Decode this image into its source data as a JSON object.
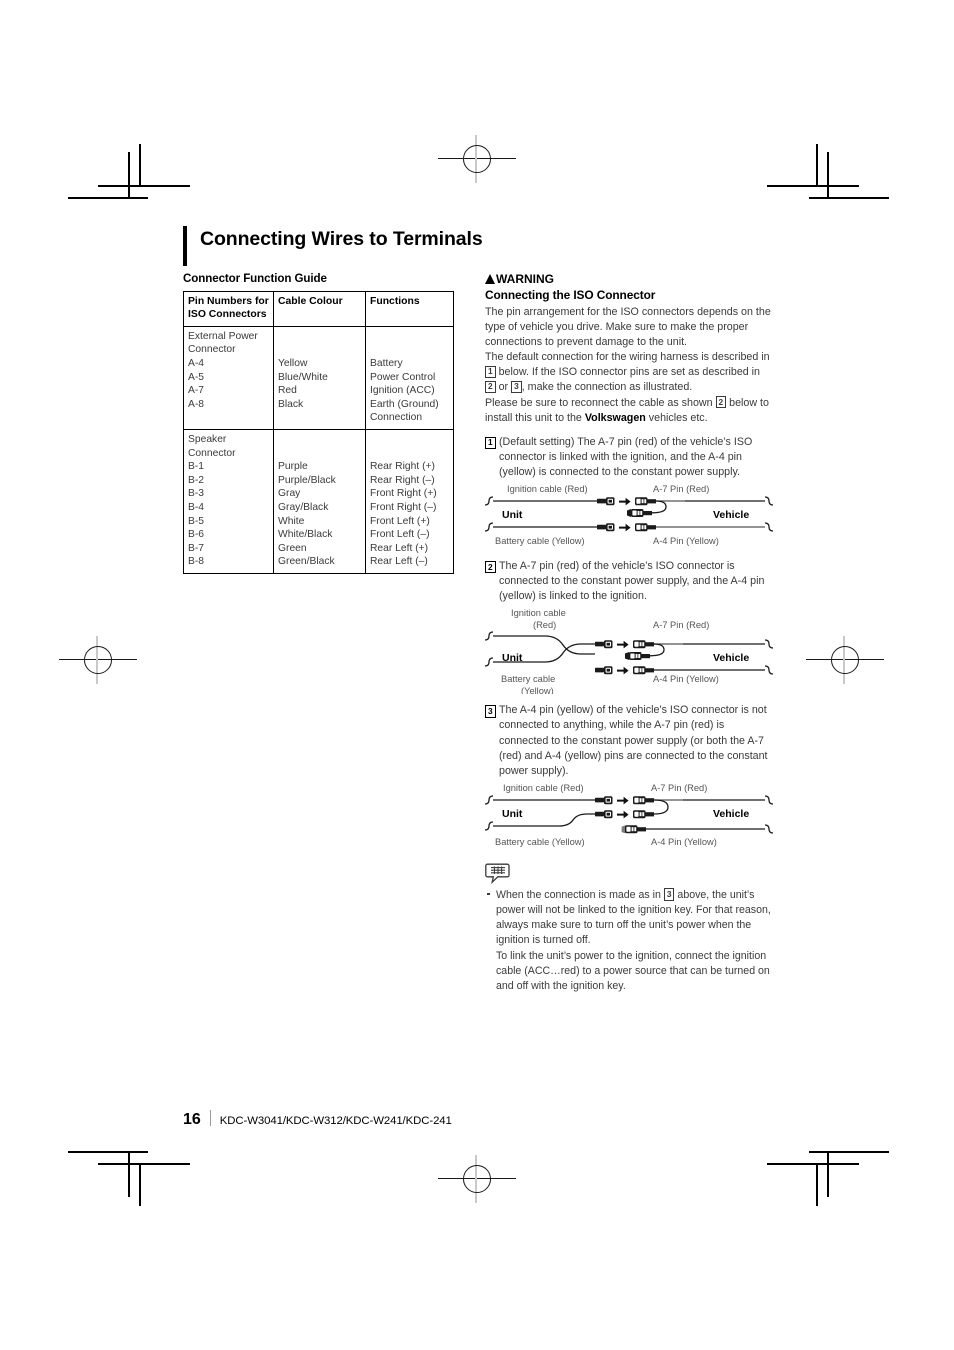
{
  "document": {
    "title": "Connecting Wires to Terminals"
  },
  "left_column": {
    "section_heading": "Connector Function Guide",
    "table": {
      "headers": [
        "Pin Numbers for ISO Connectors",
        "Cable Colour",
        "Functions"
      ],
      "header_lines": [
        [
          "Pin Numbers for",
          "ISO Connectors"
        ],
        [
          "Cable Colour"
        ],
        [
          "Functions"
        ]
      ],
      "groups": [
        {
          "name": "External Power Connector",
          "pin_lines": [
            "External Power",
            "Connector",
            "A-4",
            "A-5",
            "A-7",
            "A-8"
          ],
          "colour_lines": [
            "Yellow",
            "Blue/White",
            "Red",
            "Black"
          ],
          "function_lines": [
            "Battery",
            "Power Control",
            "Ignition (ACC)",
            "Earth (Ground)",
            "Connection"
          ],
          "rows": [
            {
              "pin": "A-4",
              "colour": "Yellow",
              "function": "Battery"
            },
            {
              "pin": "A-5",
              "colour": "Blue/White",
              "function": "Power Control"
            },
            {
              "pin": "A-7",
              "colour": "Red",
              "function": "Ignition (ACC)"
            },
            {
              "pin": "A-8",
              "colour": "Black",
              "function": "Earth (Ground) Connection"
            }
          ]
        },
        {
          "name": "Speaker Connector",
          "pin_lines": [
            "Speaker",
            "Connector",
            "B-1",
            "B-2",
            "B-3",
            "B-4",
            "B-5",
            "B-6",
            "B-7",
            "B-8"
          ],
          "colour_lines": [
            "Purple",
            "Purple/Black",
            "Gray",
            "Gray/Black",
            "White",
            "White/Black",
            "Green",
            "Green/Black"
          ],
          "function_lines": [
            "Rear Right (+)",
            "Rear Right (–)",
            "Front Right (+)",
            "Front Right (–)",
            "Front Left (+)",
            "Front Left (–)",
            "Rear Left (+)",
            "Rear Left (–)"
          ],
          "rows": [
            {
              "pin": "B-1",
              "colour": "Purple",
              "function": "Rear Right (+)"
            },
            {
              "pin": "B-2",
              "colour": "Purple/Black",
              "function": "Rear Right (–)"
            },
            {
              "pin": "B-3",
              "colour": "Gray",
              "function": "Front Right (+)"
            },
            {
              "pin": "B-4",
              "colour": "Gray/Black",
              "function": "Front Right (–)"
            },
            {
              "pin": "B-5",
              "colour": "White",
              "function": "Front Left (+)"
            },
            {
              "pin": "B-6",
              "colour": "White/Black",
              "function": "Front Left (–)"
            },
            {
              "pin": "B-7",
              "colour": "Green",
              "function": "Rear Left (+)"
            },
            {
              "pin": "B-8",
              "colour": "Green/Black",
              "function": "Rear Left (–)"
            }
          ]
        }
      ]
    }
  },
  "right_column": {
    "warning_label": "WARNING",
    "warning_heading": "Connecting the ISO Connector",
    "intro_paragraph_1": "The pin arrangement for the ISO connectors depends on the type of vehicle you drive. Make sure to make the proper connections to prevent damage to the unit.",
    "intro_paragraph_2_a": "The default connection for the wiring harness is described in",
    "intro_paragraph_2_b": "below. If the ISO connector pins are set as described in",
    "intro_paragraph_2_c": "or",
    "intro_paragraph_2_d": ", make the connection as illustrated.",
    "intro_paragraph_3_a": "Please be sure to reconnect the cable as shown",
    "intro_paragraph_3_b": "below to install this unit to the",
    "intro_paragraph_3_brand": "Volkswagen",
    "intro_paragraph_3_c": "vehicles etc.",
    "items": [
      {
        "number": "1",
        "text": "(Default setting) The A-7 pin (red) of the vehicle’s ISO connector is linked with the ignition, and the A-4 pin (yellow) is connected to the constant power supply.",
        "diagram": {
          "top_left_label": "Ignition cable (Red)",
          "top_right_label": "A-7 Pin (Red)",
          "bottom_left_label": "Battery cable (Yellow)",
          "bottom_right_label": "A-4 Pin (Yellow)",
          "unit_label": "Unit",
          "vehicle_label": "Vehicle"
        }
      },
      {
        "number": "2",
        "text": "The A-7 pin (red) of the vehicle’s ISO connector is connected to the constant power supply, and the A-4 pin (yellow) is linked to the ignition.",
        "diagram": {
          "top_left_label_line1": "Ignition cable",
          "top_left_label_line2": "(Red)",
          "top_right_label": "A-7 Pin (Red)",
          "bottom_left_label_line1": "Battery cable",
          "bottom_left_label_line2": "(Yellow)",
          "bottom_right_label": "A-4 Pin (Yellow)",
          "unit_label": "Unit",
          "vehicle_label": "Vehicle"
        }
      },
      {
        "number": "3",
        "text": "The A-4 pin (yellow) of the vehicle’s ISO connector is not connected to anything, while the A-7 pin (red) is connected to the constant power supply (or both the A-7 (red) and A-4 (yellow) pins are connected to the constant power supply).",
        "diagram": {
          "top_left_label": "Ignition cable (Red)",
          "top_right_label": "A-7 Pin (Red)",
          "bottom_left_label": "Battery cable (Yellow)",
          "bottom_right_label": "A-4 Pin (Yellow)",
          "unit_label": "Unit",
          "vehicle_label": "Vehicle"
        }
      }
    ],
    "note": {
      "icon": "note-speech-bubble-icon",
      "bullet_part_1": "When the connection is made as in",
      "bullet_number": "3",
      "bullet_part_2": "above, the unit’s power will not be linked to the ignition key. For that reason, always make sure to turn off the unit’s power when the ignition is turned off.",
      "bullet_part_3": "To link the unit’s power to the ignition, connect the ignition cable (ACC…red) to a power source that can be turned on and off with the ignition key."
    }
  },
  "footer": {
    "page_number": "16",
    "models": "KDC-W3041/KDC-W312/KDC-W241/KDC-241"
  }
}
